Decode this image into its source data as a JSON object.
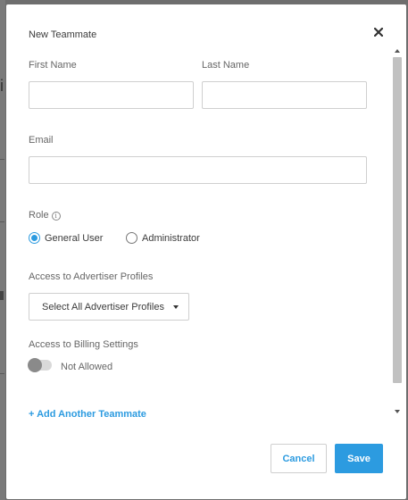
{
  "modal": {
    "title": "New Teammate",
    "close_icon": "close-icon"
  },
  "form": {
    "first_name": {
      "label": "First Name",
      "value": "",
      "placeholder": ""
    },
    "last_name": {
      "label": "Last Name",
      "value": "",
      "placeholder": ""
    },
    "email": {
      "label": "Email",
      "value": "",
      "placeholder": ""
    },
    "role": {
      "label": "Role",
      "info_icon": "info-icon",
      "options": [
        {
          "label": "General User",
          "selected": true
        },
        {
          "label": "Administrator",
          "selected": false
        }
      ]
    },
    "advertiser_profiles": {
      "label": "Access to Advertiser Profiles",
      "selected": "Select All Advertiser Profiles"
    },
    "billing": {
      "label": "Access to Billing Settings",
      "toggle_on": false,
      "state_text": "Not Allowed"
    },
    "add_link": "+ Add Another Teammate"
  },
  "footer": {
    "cancel_label": "Cancel",
    "save_label": "Save"
  },
  "background": {
    "letter": "i"
  },
  "colors": {
    "accent": "#2c9be0",
    "overlay": "#6e6e6e"
  }
}
